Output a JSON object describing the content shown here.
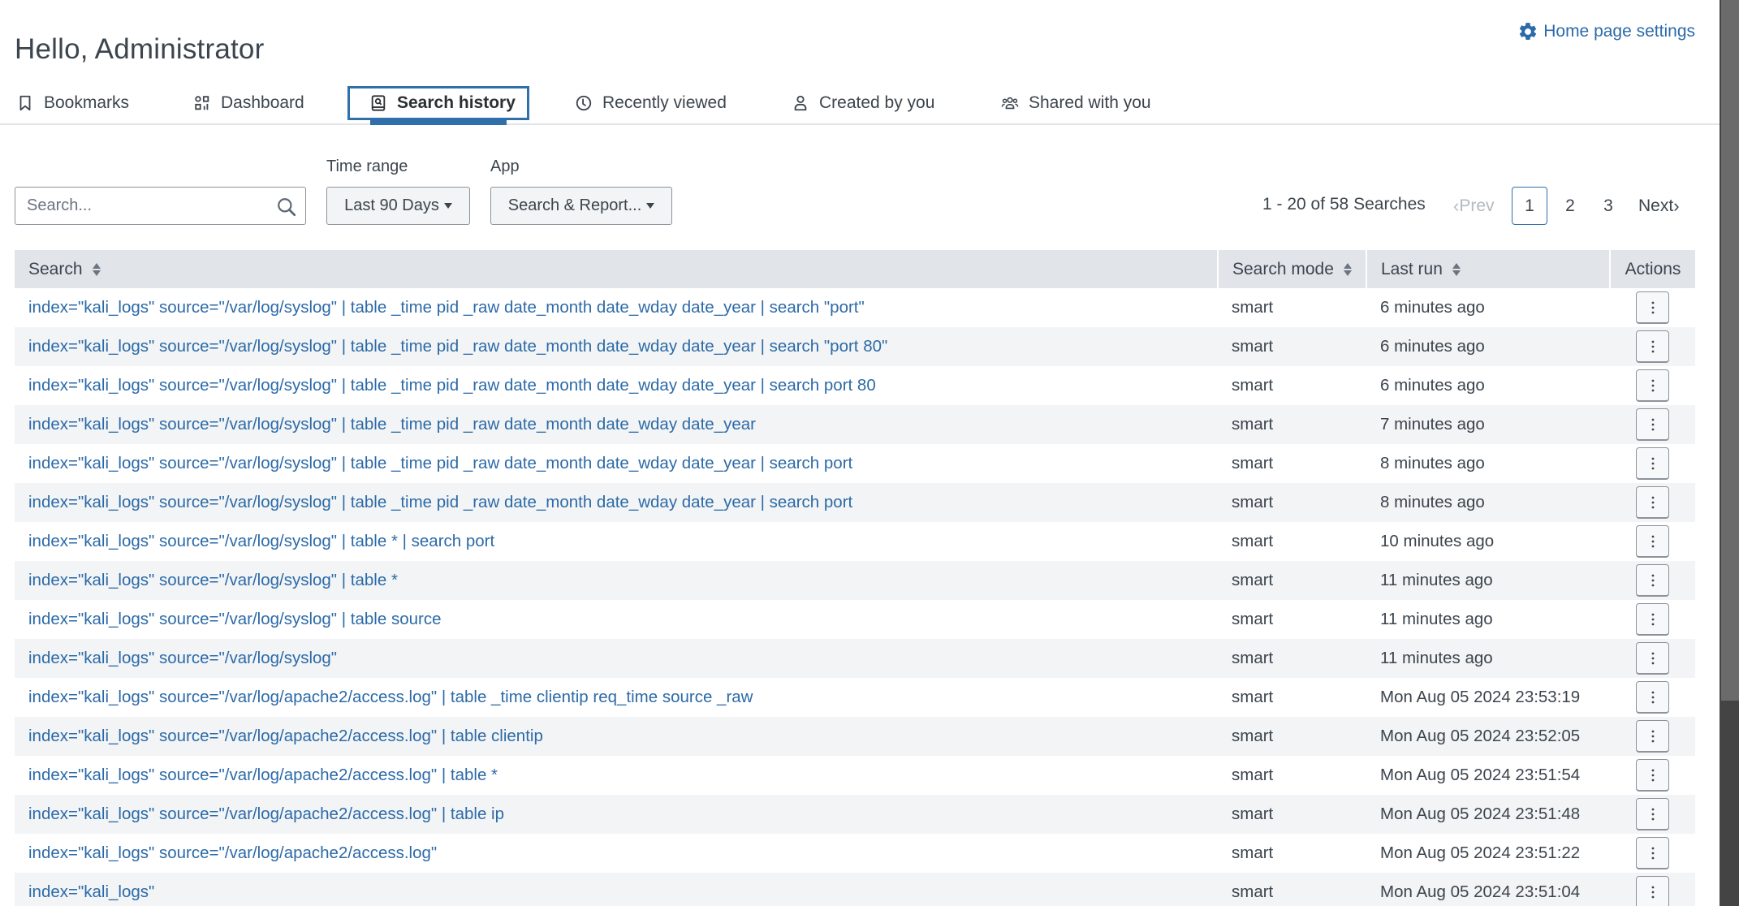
{
  "header": {
    "title": "Hello, Administrator",
    "settings_label": "Home page settings"
  },
  "tabs": [
    {
      "label": "Bookmarks",
      "icon": "bookmark-icon",
      "active": false
    },
    {
      "label": "Dashboard",
      "icon": "dashboard-icon",
      "active": false
    },
    {
      "label": "Search history",
      "icon": "search-history-icon",
      "active": true
    },
    {
      "label": "Recently viewed",
      "icon": "clock-icon",
      "active": false
    },
    {
      "label": "Created by you",
      "icon": "user-icon",
      "active": false
    },
    {
      "label": "Shared with you",
      "icon": "users-icon",
      "active": false
    }
  ],
  "filters": {
    "search_placeholder": "Search...",
    "search_value": "",
    "time_range_label": "Time range",
    "time_range_value": "Last 90 Days",
    "app_label": "App",
    "app_value": "Search & Report..."
  },
  "pagination": {
    "summary": "1 - 20 of 58 Searches",
    "prev_label": "Prev",
    "next_label": "Next",
    "pages": [
      "1",
      "2",
      "3"
    ],
    "current_page": "1"
  },
  "table": {
    "columns": {
      "search": "Search",
      "search_mode": "Search mode",
      "last_run": "Last run",
      "actions": "Actions"
    },
    "rows": [
      {
        "search": "index=\"kali_logs\" source=\"/var/log/syslog\" | table _time pid _raw date_month date_wday date_year | search \"port\"",
        "mode": "smart",
        "last_run": "6 minutes ago"
      },
      {
        "search": "index=\"kali_logs\" source=\"/var/log/syslog\" | table _time pid _raw date_month date_wday date_year | search \"port 80\"",
        "mode": "smart",
        "last_run": "6 minutes ago"
      },
      {
        "search": "index=\"kali_logs\" source=\"/var/log/syslog\" | table _time pid _raw date_month date_wday date_year | search port 80",
        "mode": "smart",
        "last_run": "6 minutes ago"
      },
      {
        "search": "index=\"kali_logs\" source=\"/var/log/syslog\" | table _time pid _raw date_month date_wday date_year",
        "mode": "smart",
        "last_run": "7 minutes ago"
      },
      {
        "search": "index=\"kali_logs\" source=\"/var/log/syslog\" | table _time pid _raw date_month date_wday date_year | search port",
        "mode": "smart",
        "last_run": "8 minutes ago"
      },
      {
        "search": "index=\"kali_logs\" source=\"/var/log/syslog\" | table _time pid _raw date_month date_wday date_year | search port",
        "mode": "smart",
        "last_run": "8 minutes ago"
      },
      {
        "search": "index=\"kali_logs\" source=\"/var/log/syslog\" | table * | search port",
        "mode": "smart",
        "last_run": "10 minutes ago"
      },
      {
        "search": "index=\"kali_logs\" source=\"/var/log/syslog\" | table *",
        "mode": "smart",
        "last_run": "11 minutes ago"
      },
      {
        "search": "index=\"kali_logs\" source=\"/var/log/syslog\" | table source",
        "mode": "smart",
        "last_run": "11 minutes ago"
      },
      {
        "search": "index=\"kali_logs\" source=\"/var/log/syslog\"",
        "mode": "smart",
        "last_run": "11 minutes ago"
      },
      {
        "search": "index=\"kali_logs\" source=\"/var/log/apache2/access.log\" | table _time clientip req_time source _raw",
        "mode": "smart",
        "last_run": "Mon Aug 05 2024 23:53:19"
      },
      {
        "search": "index=\"kali_logs\" source=\"/var/log/apache2/access.log\" | table clientip",
        "mode": "smart",
        "last_run": "Mon Aug 05 2024 23:52:05"
      },
      {
        "search": "index=\"kali_logs\" source=\"/var/log/apache2/access.log\" | table *",
        "mode": "smart",
        "last_run": "Mon Aug 05 2024 23:51:54"
      },
      {
        "search": "index=\"kali_logs\" source=\"/var/log/apache2/access.log\" | table ip",
        "mode": "smart",
        "last_run": "Mon Aug 05 2024 23:51:48"
      },
      {
        "search": "index=\"kali_logs\" source=\"/var/log/apache2/access.log\"",
        "mode": "smart",
        "last_run": "Mon Aug 05 2024 23:51:22"
      },
      {
        "search": "index=\"kali_logs\"",
        "mode": "smart",
        "last_run": "Mon Aug 05 2024 23:51:04"
      }
    ]
  },
  "colors": {
    "accent": "#2f6fab",
    "link": "#2c6aa8",
    "header_bg": "#e1e5ea",
    "stripe_bg": "#f2f4f5",
    "text": "#3c444d"
  }
}
